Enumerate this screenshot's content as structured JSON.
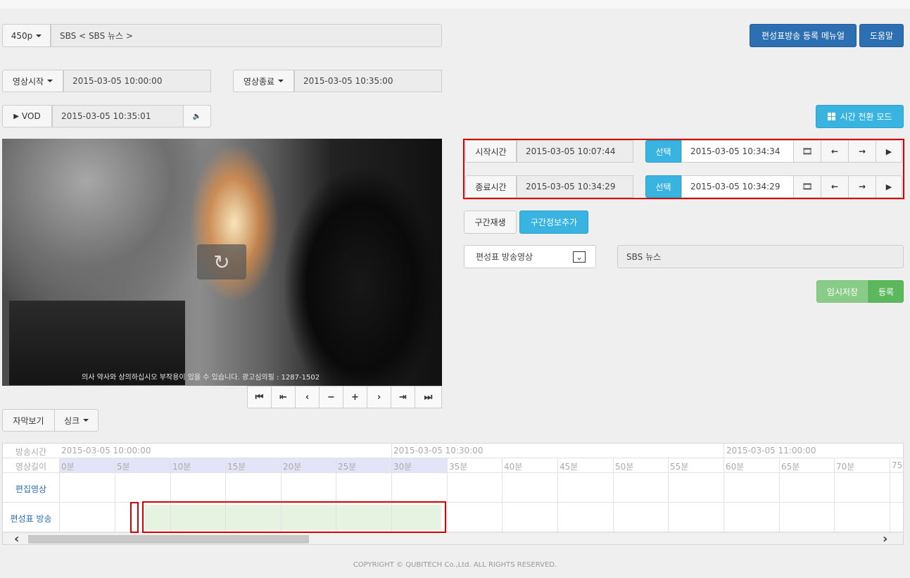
{
  "quality": {
    "label": "450p"
  },
  "channel": {
    "text": "SBS < SBS 뉴스 >"
  },
  "header": {
    "manual_button": "편성표방송 등록 메뉴얼",
    "help_button": "도움말"
  },
  "video_start": {
    "label": "영상시작",
    "value": "2015-03-05 10:00:00"
  },
  "video_end": {
    "label": "영상종료",
    "value": "2015-03-05 10:35:00"
  },
  "vod": {
    "label": "VOD",
    "value": "2015-03-05 10:35:01",
    "play_icon": "▶",
    "sound_icon": "🔈"
  },
  "time_mode_button": "시간 전환 모드",
  "player": {
    "caption": "의사 약사와 상의하십시오 부작용이 있을 수 있습니다.    광고심의필 : 1287-1502",
    "replay_icon": "↻"
  },
  "player_controls": [
    "⏮",
    "⇤",
    "‹",
    "−",
    "+",
    "›",
    "⇥",
    "⏭"
  ],
  "segment": {
    "start": {
      "label": "시작시간",
      "value": "2015-03-05 10:07:44",
      "select": "선택",
      "picked": "2015-03-05 10:34:34"
    },
    "end": {
      "label": "종료시간",
      "value": "2015-03-05 10:34:29",
      "select": "선택",
      "picked": "2015-03-05 10:34:29"
    },
    "icons": {
      "film": "🎞",
      "left": "←",
      "right": "→",
      "play": "▶"
    }
  },
  "section_play_button": "구간재생",
  "section_add_button": "구간정보추가",
  "category_select": {
    "value": "편성표 방송영상",
    "arrow": "⌄"
  },
  "program_name": "SBS 뉴스",
  "temp_save_button": "임시저장",
  "register_button": "등록",
  "subtitle_button": "자막보기",
  "sync_button": "싱크",
  "timeline": {
    "broadcast_label": "방송시간",
    "length_label": "영상길이",
    "edit_label": "편집영상",
    "schedule_label": "편성표 방송",
    "broadcast_ticks": [
      "2015-03-05 10:00:00",
      "2015-03-05 10:30:00",
      "2015-03-05 11:00:00"
    ],
    "minute_ticks": [
      "0분",
      "5분",
      "10분",
      "15분",
      "20분",
      "25분",
      "30분",
      "35분",
      "40분",
      "45분",
      "50분",
      "55분",
      "60분",
      "65분",
      "70분",
      "75"
    ],
    "scroll_left": "‹",
    "scroll_right": "›"
  },
  "copyright": "COPYRIGHT © QUBITECH Co.,Ltd. ALL RIGHTS RESERVED."
}
